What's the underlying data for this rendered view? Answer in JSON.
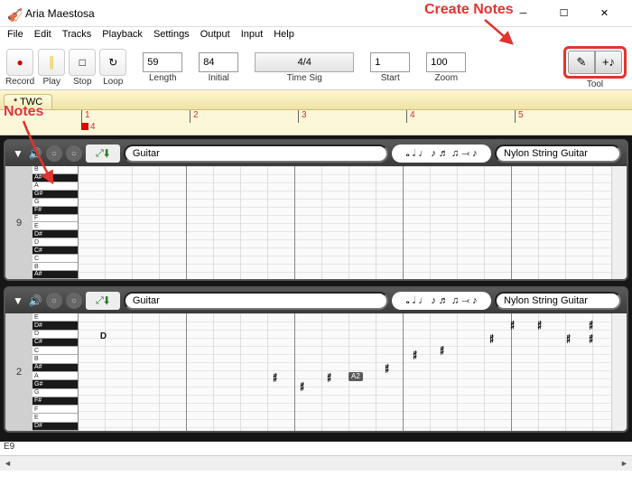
{
  "window": {
    "title": "Aria Maestosa"
  },
  "menu": [
    "File",
    "Edit",
    "Tracks",
    "Playback",
    "Settings",
    "Output",
    "Input",
    "Help"
  ],
  "toolbar": {
    "record": "Record",
    "play": "Play",
    "stop": "Stop",
    "loop": "Loop",
    "length_value": "59",
    "length_label": "Length",
    "initial_value": "84",
    "initial_label": "Initial",
    "timesig_value": "4/4",
    "timesig_label": "Time Sig",
    "start_value": "1",
    "start_label": "Start",
    "zoom_value": "100",
    "zoom_label": "Zoom",
    "tool_label": "Tool"
  },
  "tab": {
    "name": "* TWC"
  },
  "ruler": {
    "marks": [
      "1",
      "2",
      "3",
      "4",
      "5"
    ],
    "marker_label": "4"
  },
  "track1": {
    "name": "Guitar",
    "instrument": "Nylon String Guitar",
    "octave": "9",
    "notes": [
      "B",
      "A#",
      "A",
      "G#",
      "G",
      "F#",
      "F",
      "E",
      "D#",
      "D",
      "C#",
      "C",
      "B",
      "A#"
    ]
  },
  "track2": {
    "name": "Guitar",
    "instrument": "Nylon String Guitar",
    "octave": "2",
    "notes": [
      "E",
      "D#",
      "D",
      "C#",
      "C",
      "B",
      "A#",
      "A",
      "G#",
      "G",
      "F#",
      "F",
      "E",
      "D#"
    ],
    "events_label_d": "D",
    "events_label_a2": "A2"
  },
  "glyph": "𝄰",
  "status": "E9",
  "annotations": {
    "create_notes": "Create Notes",
    "notes": "Notes"
  }
}
